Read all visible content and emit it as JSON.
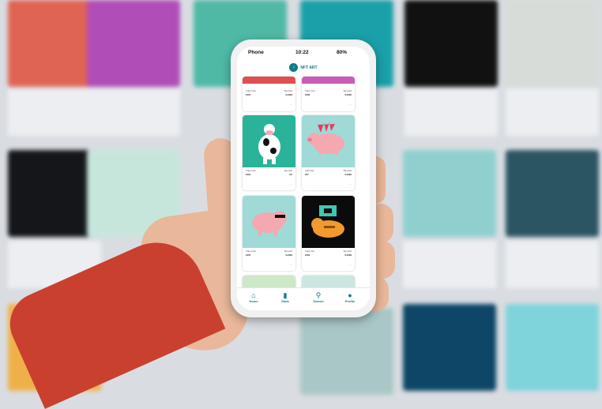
{
  "status_bar": {
    "carrier": "Phone",
    "time": "10:22",
    "battery": "80%"
  },
  "app": {
    "title": "NFT ART"
  },
  "cards": [
    {
      "name": "Crazy Cow",
      "id": "#107",
      "bid_label": "Top point",
      "bid": "0.0404"
    },
    {
      "name": "Crazy Cow",
      "id": "#150",
      "bid_label": "Top point",
      "bid": "0.0404"
    },
    {
      "name": "Crazy Cow",
      "id": "#101",
      "bid_label": "Top point",
      "bid": "0.5"
    },
    {
      "name": "Crazy Pig",
      "id": "#77",
      "bid_label": "Top point",
      "bid": "0.0404"
    },
    {
      "name": "Crazy Cow",
      "id": "#107",
      "bid_label": "Top point",
      "bid": "0.0404"
    },
    {
      "name": "Crazy Cat",
      "id": "#101",
      "bid_label": "Top point",
      "bid": "0.0404"
    }
  ],
  "nav": [
    {
      "label": "Home",
      "icon": "home-icon"
    },
    {
      "label": "Stats",
      "icon": "stats-icon"
    },
    {
      "label": "Search",
      "icon": "search-icon"
    },
    {
      "label": "Profile",
      "icon": "profile-icon"
    }
  ],
  "colors": {
    "accent": "#0d7d86",
    "card_green": "#2bb39a",
    "card_pink": "#f7c9cb",
    "card_teal": "#9fdad7",
    "card_dark": "#0b0b0b",
    "sleeve": "#c9402e"
  }
}
